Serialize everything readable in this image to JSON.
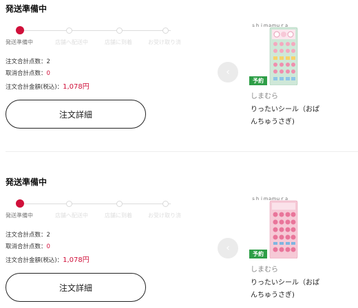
{
  "orders": [
    {
      "status_title": "発送準備中",
      "steps": [
        "発送準備中",
        "店舗へ配送中",
        "店舗に到着",
        "お受け取り済"
      ],
      "order_count_label": "注文合計点数：",
      "order_count": "2",
      "cancel_count_label": "取消合計点数：",
      "cancel_count": "0",
      "total_label": "注文合計金額(税込)：",
      "total": "1,078円",
      "detail_button": "注文詳細",
      "product": {
        "badge": "予約",
        "brand": "しまむら",
        "name": "りったいシール（おぱんちゅうさぎ)",
        "image_theme": "green-sticker-sheet"
      }
    },
    {
      "status_title": "発送準備中",
      "steps": [
        "発送準備中",
        "店舗へ配送中",
        "店舗に到着",
        "お受け取り済"
      ],
      "order_count_label": "注文合計点数：",
      "order_count": "2",
      "cancel_count_label": "取消合計点数：",
      "cancel_count": "0",
      "total_label": "注文合計金額(税込)：",
      "total": "1,078円",
      "detail_button": "注文詳細",
      "product": {
        "badge": "予約",
        "brand": "しまむら",
        "name": "りったいシール（おぱんちゅうさぎ)",
        "image_theme": "pink-sticker-sheet"
      }
    }
  ],
  "colors": {
    "accent": "#d0103a",
    "badge": "#2e9e47"
  },
  "icons": {
    "prev": "chevron-left-icon"
  }
}
